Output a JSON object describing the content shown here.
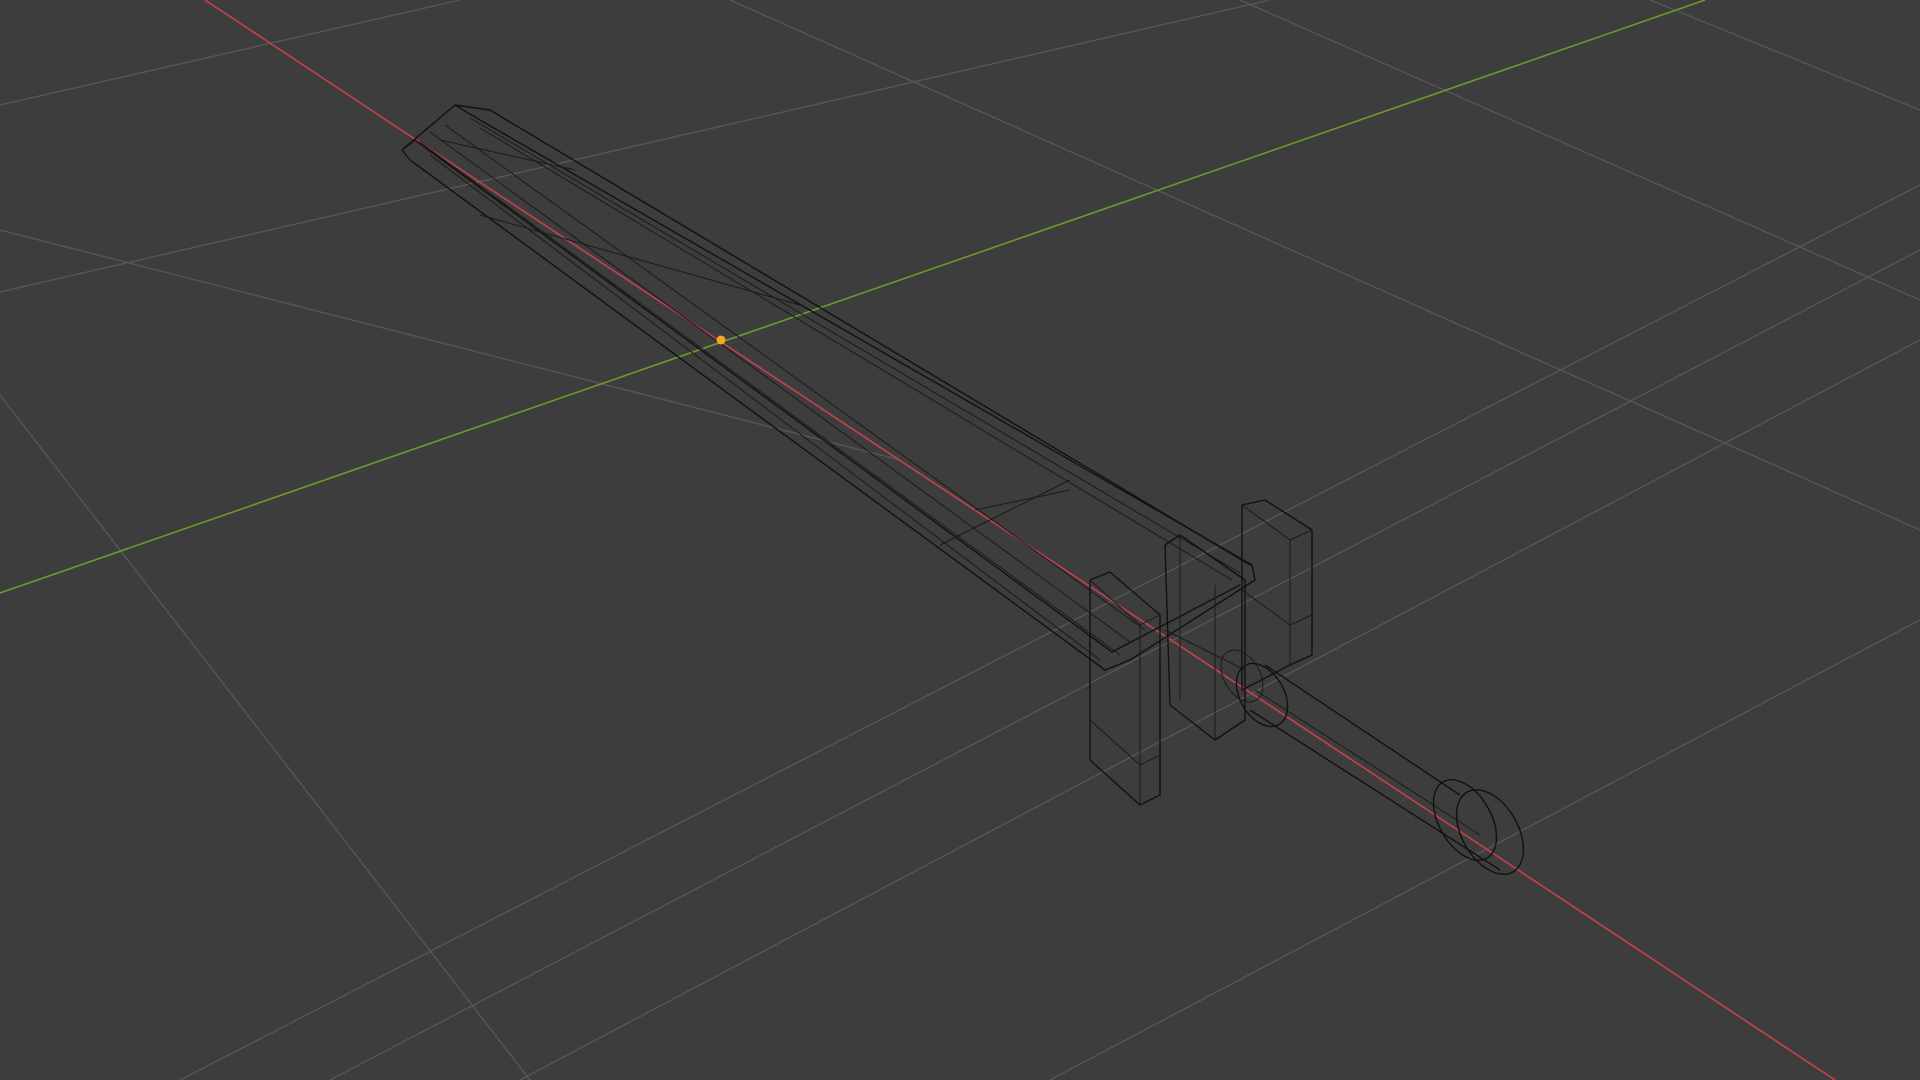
{
  "viewport": {
    "mode": "wireframe",
    "background_color": "#3d3d3d",
    "grid_color": "#565656",
    "x_axis_color": "#c8404c",
    "y_axis_color": "#6b9a2e",
    "wire_color": "#111111",
    "origin_color": "#f5a623"
  },
  "object": {
    "name_icon": "sword-mesh-icon",
    "parts": [
      "blade",
      "crossguard",
      "grip"
    ]
  }
}
